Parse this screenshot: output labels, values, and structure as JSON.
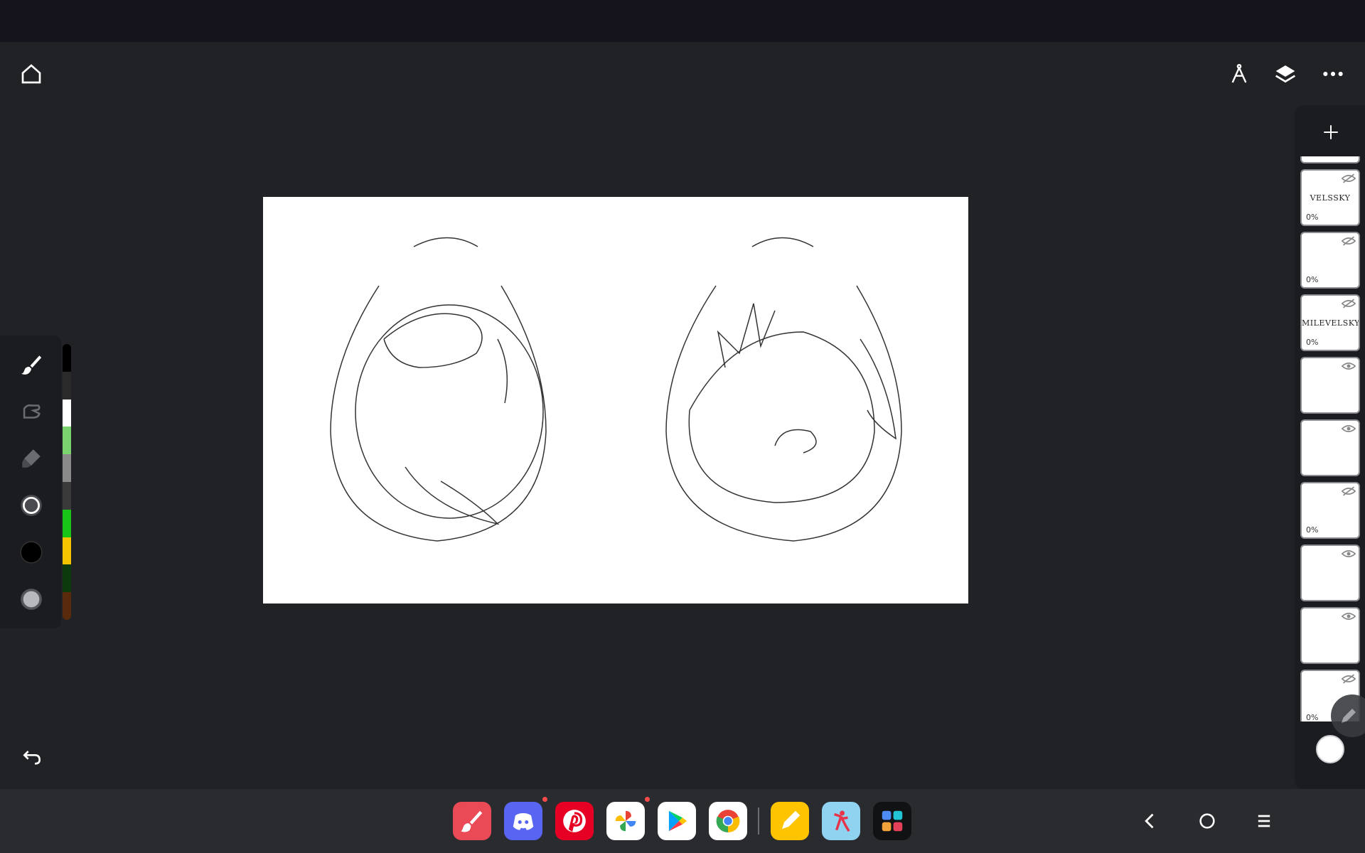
{
  "colors": {
    "background": "#212226",
    "status_bar": "#15141c",
    "panel": "#1b1c20",
    "taskbar": "#2a2b2f",
    "canvas": "#ffffff",
    "current_color": "#000000"
  },
  "icons": {
    "home": "home-icon",
    "ruler": "ruler-compass-icon",
    "layers": "layers-icon",
    "more": "more-dots-icon",
    "brush": "brush-icon",
    "smudge": "smudge-icon",
    "eraser": "eraser-icon",
    "brush_size": "brush-size-circle-icon",
    "color": "color-swatch-icon",
    "opacity": "opacity-circle-icon",
    "undo": "undo-icon",
    "add_layer": "plus-icon"
  },
  "palette": [
    "#000000",
    "#2a2a2a",
    "#ffffff",
    "#7ad36f",
    "#8a8a8a",
    "#3a3a3a",
    "#18c516",
    "#f4c400",
    "#0c3a0c",
    "#5a2a0c"
  ],
  "layers": [
    {
      "thumb_text": "VELSSKY",
      "opacity": "0%",
      "visible": false
    },
    {
      "thumb_text": "",
      "opacity": "0%",
      "visible": false
    },
    {
      "thumb_text": "MILEVELSKY",
      "opacity": "0%",
      "visible": false
    },
    {
      "thumb_text": "",
      "opacity": "",
      "visible": true
    },
    {
      "thumb_text": "",
      "opacity": "",
      "visible": true
    },
    {
      "thumb_text": "",
      "opacity": "0%",
      "visible": false
    },
    {
      "thumb_text": "",
      "opacity": "",
      "visible": true
    },
    {
      "thumb_text": "",
      "opacity": "",
      "visible": true
    },
    {
      "thumb_text": "",
      "opacity": "0%",
      "visible": false
    }
  ],
  "taskbar": {
    "apps": [
      "ibisPaint",
      "Discord",
      "Pinterest",
      "Google Photos",
      "Google Play",
      "Chrome",
      "Notes",
      "Sketchbook",
      "App Drawer"
    ]
  }
}
